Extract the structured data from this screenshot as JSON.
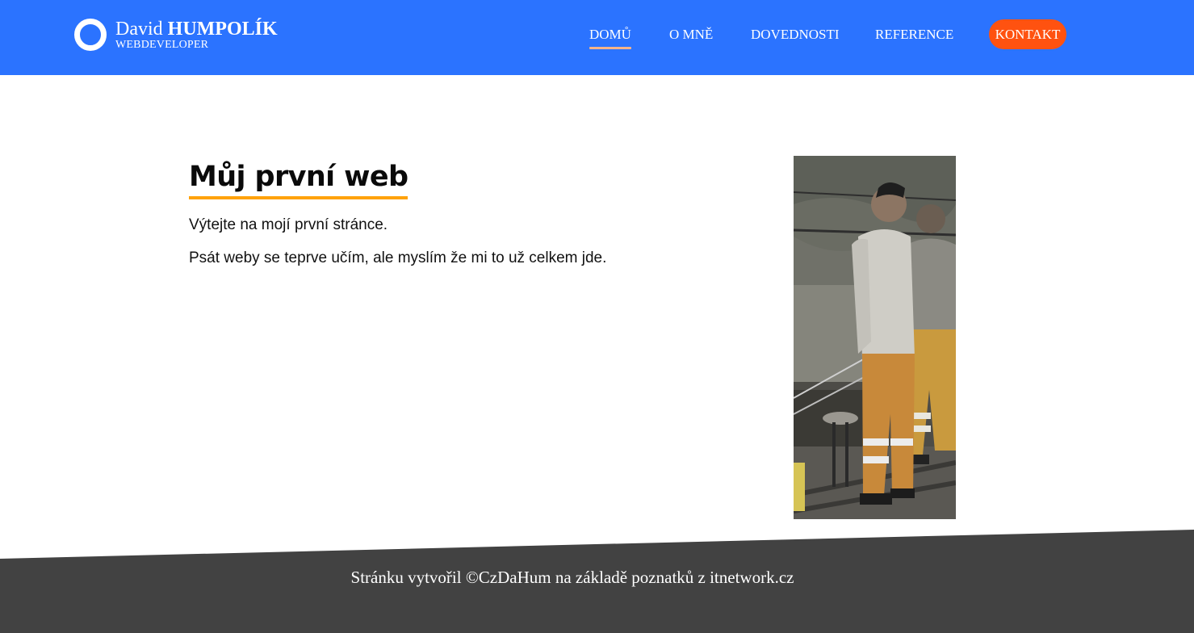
{
  "header": {
    "logo": {
      "first_name": "David",
      "last_name": "HUMPOLÍK",
      "subtitle": "WEBDEVELOPER"
    },
    "nav": {
      "items": [
        {
          "label": "DOMŮ",
          "active": true
        },
        {
          "label": "O MNĚ",
          "active": false
        },
        {
          "label": "DOVEDNOSTI",
          "active": false
        },
        {
          "label": "REFERENCE",
          "active": false
        }
      ],
      "cta_label": "KONTAKT"
    }
  },
  "main": {
    "title": "Můj první web",
    "paragraphs": [
      "Výtejte na mojí první stránce.",
      "Psát weby se teprve učím, ale myslím že mi to už celkem jde."
    ]
  },
  "footer": {
    "text": "Stránku vytvořil ©CzDaHum na základě poznatků z itnetwork.cz"
  },
  "colors": {
    "header_bg": "#2b73ff",
    "cta_bg": "#ff5210",
    "title_underline": "#ffa20a",
    "footer_bg": "#424242"
  }
}
